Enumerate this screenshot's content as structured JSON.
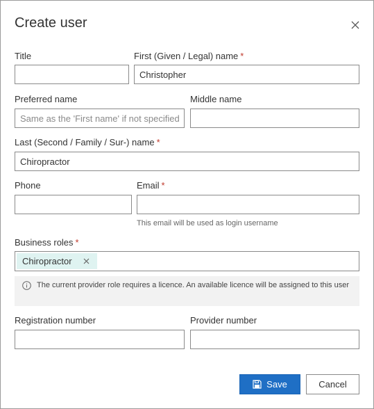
{
  "dialog": {
    "title": "Create user",
    "close_icon": "close-icon"
  },
  "required_marker": "*",
  "fields": {
    "title": {
      "label": "Title",
      "value": ""
    },
    "first_name": {
      "label": "First (Given / Legal) name",
      "value": "Christopher",
      "required": true
    },
    "preferred_name": {
      "label": "Preferred name",
      "value": "",
      "placeholder": "Same as the 'First name' if not specified"
    },
    "middle_name": {
      "label": "Middle name",
      "value": ""
    },
    "last_name": {
      "label": "Last (Second / Family / Sur-) name",
      "value": "Chiropractor",
      "required": true
    },
    "phone": {
      "label": "Phone",
      "value": ""
    },
    "email": {
      "label": "Email",
      "value": "",
      "required": true,
      "hint": "This email will be used as login username"
    },
    "business_roles": {
      "label": "Business roles",
      "required": true,
      "tags": [
        "Chiropractor"
      ]
    },
    "registration_number": {
      "label": "Registration number",
      "value": ""
    },
    "provider_number": {
      "label": "Provider number",
      "value": ""
    }
  },
  "notice": {
    "icon": "info-icon",
    "text": "The current provider role requires a licence. An available licence will be assigned to this user"
  },
  "buttons": {
    "save_label": "Save",
    "save_icon": "save-icon",
    "cancel_label": "Cancel"
  },
  "colors": {
    "primary": "#1f6fc5",
    "required": "#c0392b",
    "tag_bg": "#dff3f1",
    "notice_bg": "#f2f2f2"
  }
}
